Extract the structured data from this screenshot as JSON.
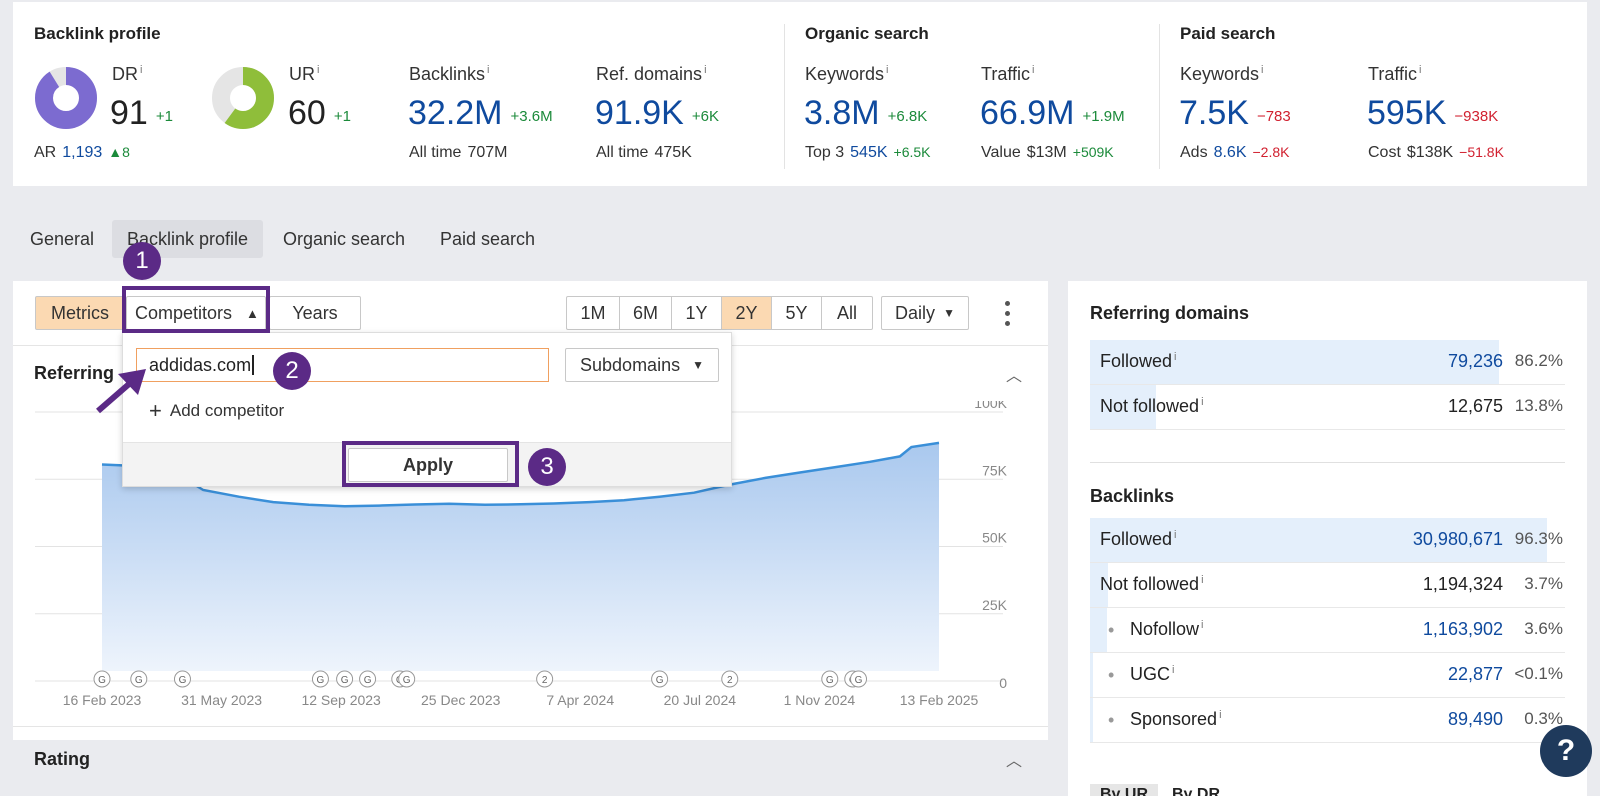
{
  "overview": {
    "backlink_profile": {
      "title": "Backlink profile",
      "dr": {
        "label": "DR",
        "value": "91",
        "delta": "+1",
        "ring_fraction": 0.91
      },
      "ur": {
        "label": "UR",
        "value": "60",
        "delta": "+1",
        "ring_fraction": 0.6
      },
      "ar": {
        "label": "AR",
        "value": "1,193",
        "delta": "8"
      },
      "backlinks": {
        "label": "Backlinks",
        "value": "32.2M",
        "delta": "+3.6M",
        "sub_label": "All time",
        "sub_value": "707M"
      },
      "ref_domains": {
        "label": "Ref. domains",
        "value": "91.9K",
        "delta": "+6K",
        "sub_label": "All time",
        "sub_value": "475K"
      }
    },
    "organic_search": {
      "title": "Organic search",
      "keywords": {
        "label": "Keywords",
        "value": "3.8M",
        "delta": "+6.8K",
        "sub_label": "Top 3",
        "sub_value": "545K",
        "sub_delta": "+6.5K"
      },
      "traffic": {
        "label": "Traffic",
        "value": "66.9M",
        "delta": "+1.9M",
        "sub_label": "Value",
        "sub_value": "$13M",
        "sub_delta": "+509K"
      }
    },
    "paid_search": {
      "title": "Paid search",
      "keywords": {
        "label": "Keywords",
        "value": "7.5K",
        "delta": "−783",
        "sub_label": "Ads",
        "sub_value": "8.6K",
        "sub_delta": "−2.8K"
      },
      "traffic": {
        "label": "Traffic",
        "value": "595K",
        "delta": "−938K",
        "sub_label": "Cost",
        "sub_value": "$138K",
        "sub_delta": "−51.8K"
      }
    },
    "info_glyph": "i"
  },
  "tabs": [
    "General",
    "Backlink profile",
    "Organic search",
    "Paid search"
  ],
  "toolbar": {
    "metrics": "Metrics",
    "competitors": "Competitors",
    "years": "Years",
    "ranges": [
      "1M",
      "6M",
      "1Y",
      "2Y",
      "5Y",
      "All"
    ],
    "active_range": "2Y",
    "interval": "Daily"
  },
  "chart_section": {
    "title": "Referring",
    "rating_title": "Rating"
  },
  "competitor_panel": {
    "input_value": "addidas.com",
    "mode": "Subdomains",
    "add_label": "Add competitor",
    "apply_label": "Apply"
  },
  "callouts": [
    "1",
    "2",
    "3"
  ],
  "chart_data": {
    "type": "area",
    "x_ticks": [
      "16 Feb 2023",
      "31 May 2023",
      "12 Sep 2023",
      "25 Dec 2023",
      "7 Apr 2024",
      "20 Jul 2024",
      "1 Nov 2024",
      "13 Feb 2025"
    ],
    "y_ticks": [
      "100K",
      "75K",
      "50K",
      "25K",
      "0"
    ],
    "ylim": [
      0,
      100000
    ],
    "series": [
      {
        "x": [
          "2023-02-16",
          "2023-03-15",
          "2023-04-15",
          "2023-05-15",
          "2023-06-15",
          "2023-07-15",
          "2023-08-15",
          "2023-09-15",
          "2023-10-15",
          "2023-11-15",
          "2023-12-15",
          "2024-01-15",
          "2024-02-15",
          "2024-03-15",
          "2024-04-15",
          "2024-05-15",
          "2024-06-15",
          "2024-07-15",
          "2024-08-15",
          "2024-09-15",
          "2024-10-15",
          "2024-11-15",
          "2024-12-15",
          "2025-01-10",
          "2025-01-20",
          "2025-02-13"
        ],
        "values": [
          80500,
          80000,
          79000,
          71000,
          68500,
          66500,
          65500,
          65000,
          65200,
          65600,
          65900,
          65500,
          65700,
          66000,
          66500,
          67200,
          68500,
          70000,
          73000,
          75500,
          77500,
          79500,
          81500,
          83500,
          87000,
          88500
        ]
      }
    ],
    "annotations": [
      {
        "date": "2023-02-16",
        "label": "G"
      },
      {
        "date": "2023-03-20",
        "label": "G"
      },
      {
        "date": "2023-04-27",
        "label": "G"
      },
      {
        "date": "2023-08-25",
        "label": "G"
      },
      {
        "date": "2023-09-15",
        "label": "G"
      },
      {
        "date": "2023-10-05",
        "label": "G"
      },
      {
        "date": "2023-11-02",
        "label": "G"
      },
      {
        "date": "2023-11-08",
        "label": "G"
      },
      {
        "date": "2024-03-07",
        "label": "2"
      },
      {
        "date": "2024-06-15",
        "label": "G"
      },
      {
        "date": "2024-08-15",
        "label": "2"
      },
      {
        "date": "2024-11-10",
        "label": "G"
      },
      {
        "date": "2024-11-30",
        "label": "G"
      },
      {
        "date": "2024-12-05",
        "label": "G"
      }
    ]
  },
  "right_panel": {
    "referring_domains": {
      "title": "Referring domains",
      "rows": [
        {
          "label": "Followed",
          "value": "79,236",
          "pct": "86.2%",
          "bar": 0.862,
          "link": true
        },
        {
          "label": "Not followed",
          "value": "12,675",
          "pct": "13.8%",
          "bar": 0.138,
          "link": false
        }
      ]
    },
    "backlinks": {
      "title": "Backlinks",
      "rows": [
        {
          "label": "Followed",
          "value": "30,980,671",
          "pct": "96.3%",
          "bar": 0.963,
          "link": true,
          "indent": false
        },
        {
          "label": "Not followed",
          "value": "1,194,324",
          "pct": "3.7%",
          "bar": 0.037,
          "link": false,
          "indent": false
        },
        {
          "label": "Nofollow",
          "value": "1,163,902",
          "pct": "3.6%",
          "bar": 0.036,
          "link": true,
          "indent": true
        },
        {
          "label": "UGC",
          "value": "22,877",
          "pct": "<0.1%",
          "bar": 0.001,
          "link": true,
          "indent": true
        },
        {
          "label": "Sponsored",
          "value": "89,490",
          "pct": "0.3%",
          "bar": 0.003,
          "link": true,
          "indent": true
        }
      ]
    },
    "sort_tabs": [
      "By UR",
      "By DR"
    ]
  },
  "help": {
    "icon": "question-icon",
    "glyph": "?"
  }
}
